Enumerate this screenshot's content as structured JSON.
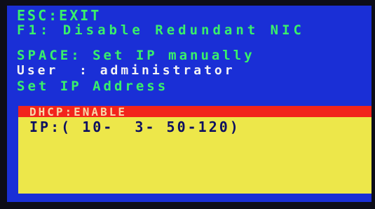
{
  "screen": {
    "lines": [
      "ESC:EXIT",
      "F1: Disable Redundant NIC",
      "SPACE: Set IP manually",
      "User  : administrator",
      "Set IP Address"
    ]
  },
  "panel": {
    "selected_option": "DHCP:ENABLE",
    "ip_line": "IP:( 10-  3- 50-120)"
  },
  "colors": {
    "background": "#1a2fd6",
    "menu_text": "#39f06a",
    "user_text": "#f4f4f6",
    "highlight_bar": "#f2241c",
    "panel": "#ede74a",
    "panel_text": "#0e1060"
  }
}
